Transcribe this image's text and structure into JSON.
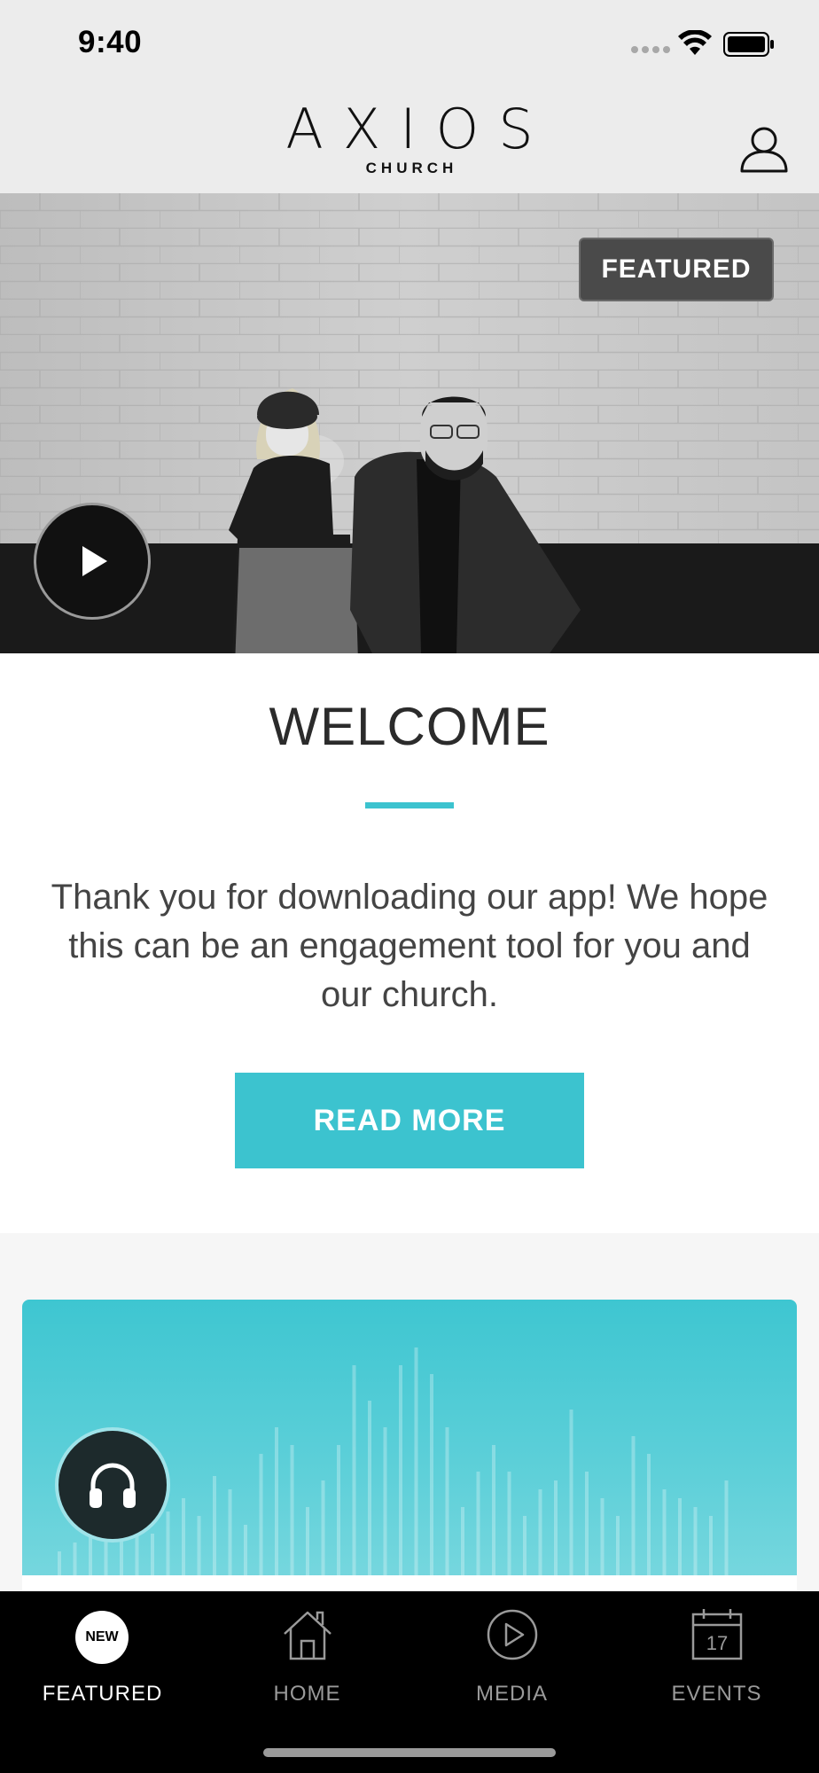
{
  "status_bar": {
    "time": "9:40",
    "icons": [
      "cellular-signal-icon",
      "wifi-icon",
      "battery-icon"
    ]
  },
  "header": {
    "logo_main": "AXIOS",
    "logo_sub": "CHURCH",
    "profile_icon": "user-profile-icon"
  },
  "hero": {
    "badge": "FEATURED",
    "play_icon": "play-icon"
  },
  "welcome": {
    "title": "WELCOME",
    "body": "Thank you for downloading our app! We hope this can be an engagement tool for you and our church.",
    "button_label": "READ MORE"
  },
  "audio_card": {
    "icon": "headphones-icon"
  },
  "tab_bar": {
    "tabs": [
      {
        "label": "FEATURED",
        "badge": "NEW",
        "active": true
      },
      {
        "label": "HOME",
        "icon": "home-icon",
        "active": false
      },
      {
        "label": "MEDIA",
        "icon": "play-circle-icon",
        "active": false
      },
      {
        "label": "EVENTS",
        "icon": "calendar-icon",
        "calendar_day": "17",
        "active": false
      }
    ]
  },
  "colors": {
    "accent": "#3cc3cf",
    "header_bg": "#ececec",
    "tab_bar_bg": "#000000"
  }
}
